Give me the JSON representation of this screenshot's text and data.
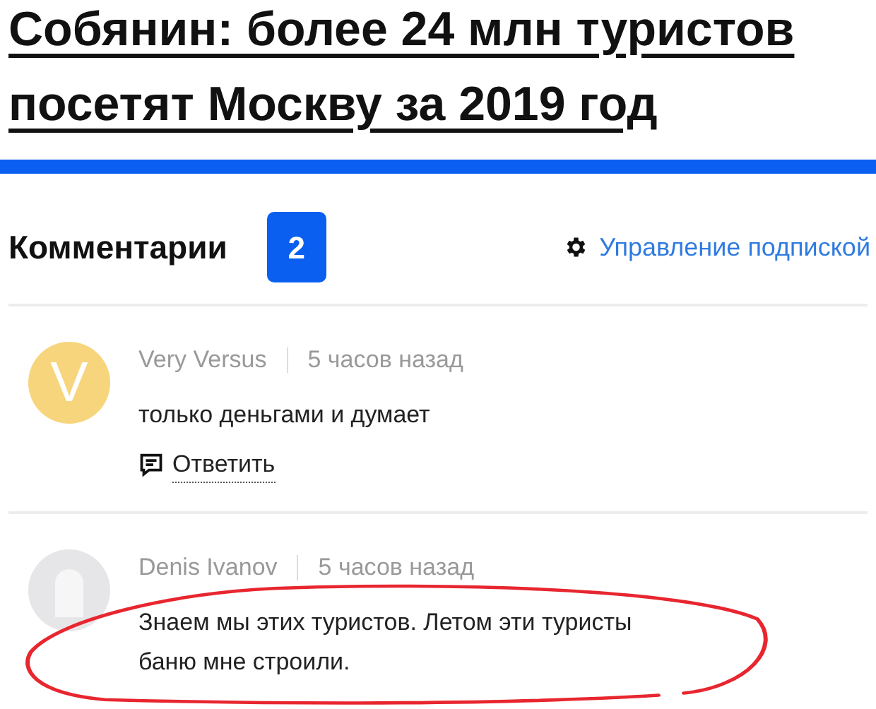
{
  "article": {
    "title": "Собянин: более 24 млн туристов посетят Москву за 2019 год"
  },
  "comments_header": {
    "title": "Комментарии",
    "count": "2",
    "subscription_link": "Управление подпиской"
  },
  "comments": [
    {
      "author": "Very Versus",
      "time": "5 часов назад",
      "text": "только деньгами и думает",
      "reply_label": "Ответить",
      "highlighted": false,
      "avatar": {
        "kind": "letter",
        "letter": "V",
        "color": "#f7d57c"
      }
    },
    {
      "author": "Denis Ivanov",
      "time": "5 часов назад",
      "text": "Знаем мы этих туристов. Летом эти туристы баню мне строили.",
      "highlighted": true,
      "avatar": {
        "kind": "default"
      }
    }
  ]
}
